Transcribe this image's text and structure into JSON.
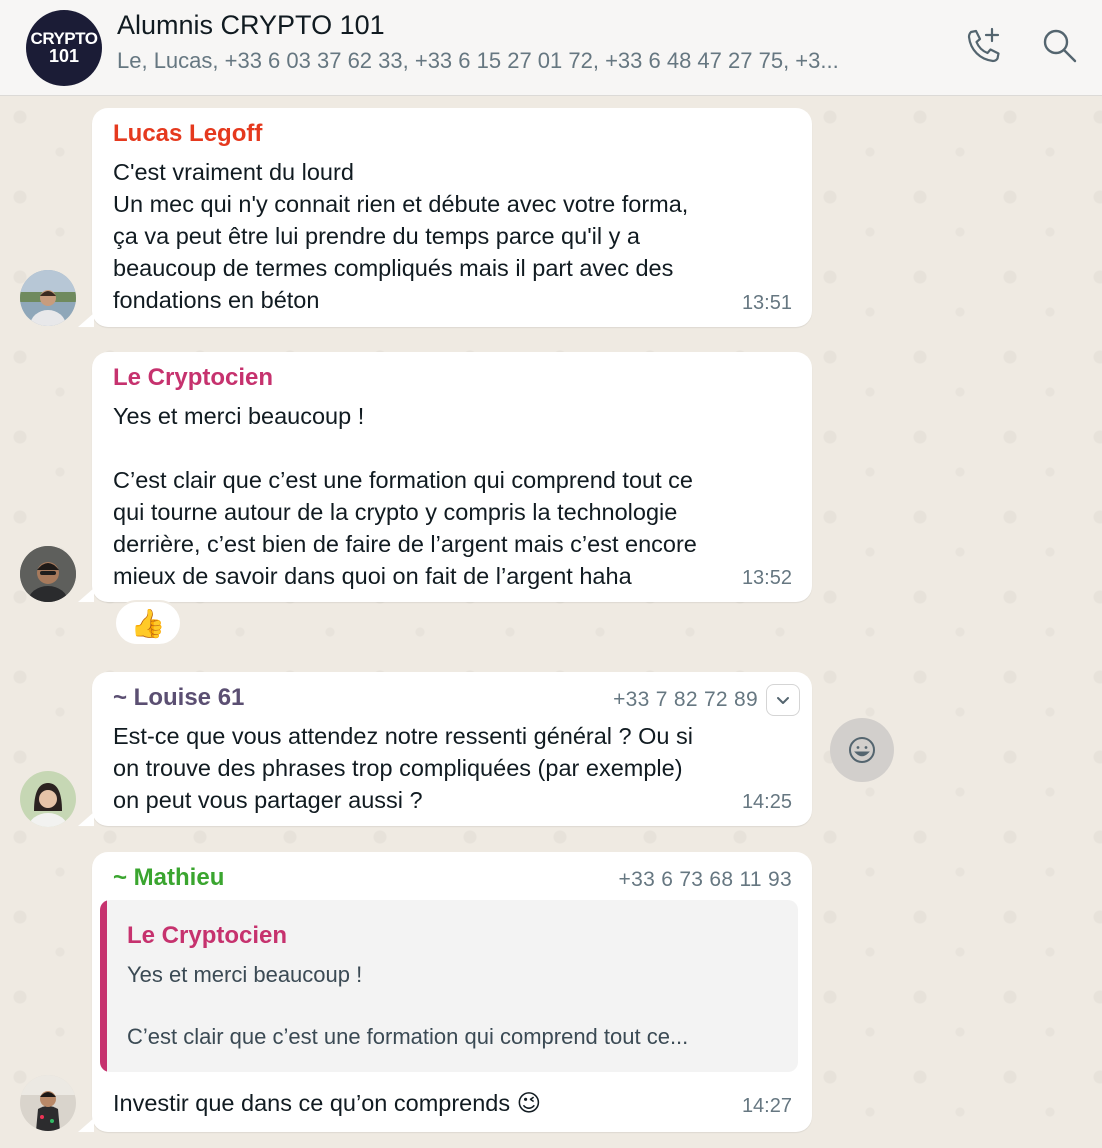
{
  "header": {
    "group_avatar_line1": "CRYPTO",
    "group_avatar_line2": "101",
    "title": "Alumnis CRYPTO 101",
    "members": "Le, Lucas, +33 6 03 37 62 33, +33 6 15 27 01 72, +33 6 48 47 27 75, +3..."
  },
  "icons": {
    "call": "add-call-icon",
    "search": "search-icon",
    "chevron": "chevron-down-icon",
    "emoji": "emoji-icon"
  },
  "colors": {
    "lucas": "#e5391e",
    "cryptocien": "#c6326e",
    "louise": "#5b4f72",
    "mathieu": "#3aa52f"
  },
  "messages": [
    {
      "sender": "Lucas Legoff",
      "text": "C'est vraiment du lourd\nUn mec qui n'y connait rien et débute avec votre forma,\nça va peut être lui prendre du temps parce qu'il y a\nbeaucoup de termes compliqués mais il part avec des\nfondations en béton",
      "time": "13:51"
    },
    {
      "sender": "Le Cryptocien",
      "text": "Yes et merci beaucoup !\n\nC’est clair que c’est une formation qui comprend tout ce\nqui tourne autour de la crypto y compris la technologie\nderrière, c’est bien de faire de l’argent mais c’est encore\nmieux de savoir dans quoi on fait de l’argent haha",
      "time": "13:52",
      "reaction": "👍"
    },
    {
      "sender": "~ Louise 61",
      "phone": "+33 7 82 72 89",
      "text": "Est-ce que vous attendez notre ressenti général ? Ou si\non trouve des phrases trop compliquées (par exemple)\non peut vous partager aussi ?",
      "time": "14:25"
    },
    {
      "sender": "~ Mathieu",
      "phone": "+33 6 73 68 11 93",
      "quote": {
        "sender": "Le Cryptocien",
        "line1": "Yes et merci beaucoup !",
        "line2": "C’est clair que c’est une formation qui comprend tout ce..."
      },
      "text": "Investir que dans ce qu’on comprends 😉",
      "time": "14:27"
    }
  ]
}
